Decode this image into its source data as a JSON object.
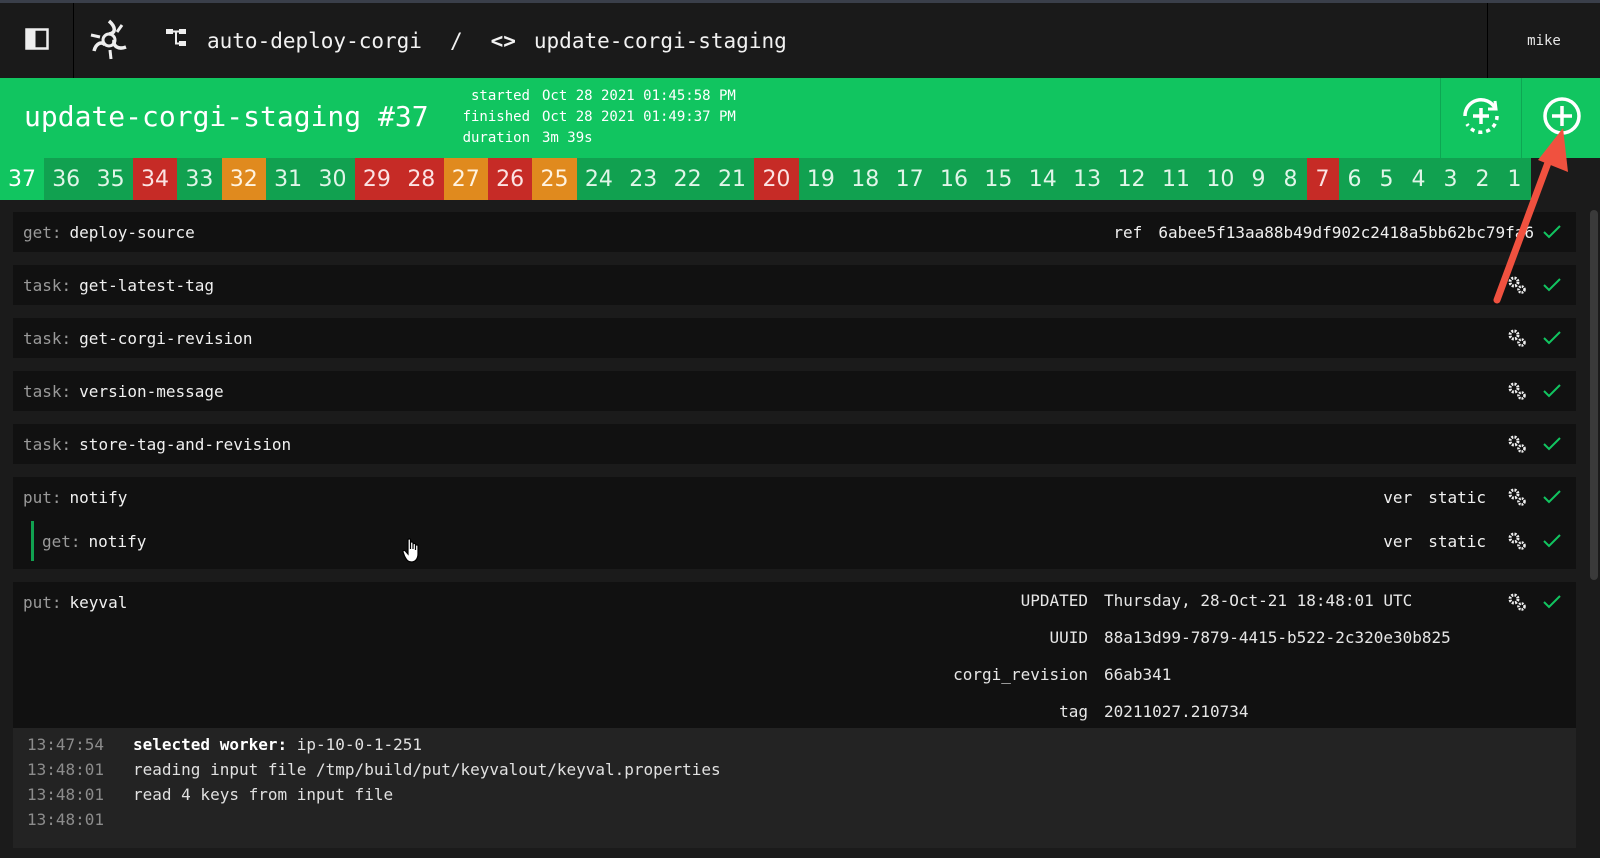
{
  "topbar": {
    "pipeline": "auto-deploy-corgi",
    "separator": "/",
    "job_icon": "<>",
    "job": "update-corgi-staging",
    "user": "mike"
  },
  "build": {
    "title": "update-corgi-staging #37",
    "started_label": "started",
    "started": "Oct 28 2021 01:45:58 PM",
    "finished_label": "finished",
    "finished": "Oct 28 2021 01:49:37 PM",
    "duration_label": "duration",
    "duration": "3m 39s"
  },
  "builds": [
    {
      "n": "37",
      "status": "current"
    },
    {
      "n": "36",
      "status": "succeeded"
    },
    {
      "n": "35",
      "status": "succeeded"
    },
    {
      "n": "34",
      "status": "failed"
    },
    {
      "n": "33",
      "status": "succeeded"
    },
    {
      "n": "32",
      "status": "errored"
    },
    {
      "n": "31",
      "status": "succeeded"
    },
    {
      "n": "30",
      "status": "succeeded"
    },
    {
      "n": "29",
      "status": "failed"
    },
    {
      "n": "28",
      "status": "failed"
    },
    {
      "n": "27",
      "status": "errored"
    },
    {
      "n": "26",
      "status": "failed"
    },
    {
      "n": "25",
      "status": "errored"
    },
    {
      "n": "24",
      "status": "succeeded"
    },
    {
      "n": "23",
      "status": "succeeded"
    },
    {
      "n": "22",
      "status": "succeeded"
    },
    {
      "n": "21",
      "status": "succeeded"
    },
    {
      "n": "20",
      "status": "failed"
    },
    {
      "n": "19",
      "status": "succeeded"
    },
    {
      "n": "18",
      "status": "succeeded"
    },
    {
      "n": "17",
      "status": "succeeded"
    },
    {
      "n": "16",
      "status": "succeeded"
    },
    {
      "n": "15",
      "status": "succeeded"
    },
    {
      "n": "14",
      "status": "succeeded"
    },
    {
      "n": "13",
      "status": "succeeded"
    },
    {
      "n": "12",
      "status": "succeeded"
    },
    {
      "n": "11",
      "status": "succeeded"
    },
    {
      "n": "10",
      "status": "succeeded"
    },
    {
      "n": "9",
      "status": "succeeded"
    },
    {
      "n": "8",
      "status": "succeeded"
    },
    {
      "n": "7",
      "status": "failed"
    },
    {
      "n": "6",
      "status": "succeeded"
    },
    {
      "n": "5",
      "status": "succeeded"
    },
    {
      "n": "4",
      "status": "succeeded"
    },
    {
      "n": "3",
      "status": "succeeded"
    },
    {
      "n": "2",
      "status": "succeeded"
    },
    {
      "n": "1",
      "status": "succeeded"
    }
  ],
  "steps": {
    "get_source": {
      "type": "get:",
      "name": "deploy-source",
      "ref_key": "ref",
      "ref_val": "6abee5f13aa88b49df902c2418a5bb62bc79fa6"
    },
    "task1": {
      "type": "task:",
      "name": "get-latest-tag"
    },
    "task2": {
      "type": "task:",
      "name": "get-corgi-revision"
    },
    "task3": {
      "type": "task:",
      "name": "version-message"
    },
    "task4": {
      "type": "task:",
      "name": "store-tag-and-revision"
    },
    "put_notify": {
      "type": "put:",
      "name": "notify",
      "k": "ver",
      "v": "static"
    },
    "get_notify": {
      "type": "get:",
      "name": "notify",
      "k": "ver",
      "v": "static"
    },
    "put_keyval": {
      "type": "put:",
      "name": "keyval",
      "rows": [
        {
          "k": "UPDATED",
          "v": "Thursday, 28-Oct-21 18:48:01 UTC"
        },
        {
          "k": "UUID",
          "v": "88a13d99-7879-4415-b522-2c320e30b825"
        },
        {
          "k": "corgi_revision",
          "v": "66ab341"
        },
        {
          "k": "tag",
          "v": "20211027.210734"
        }
      ]
    }
  },
  "log": [
    {
      "ts": "13:47:54",
      "bold": "selected worker:",
      "text": " ip-10-0-1-251"
    },
    {
      "ts": "13:48:01",
      "bold": "",
      "text": "reading input file /tmp/build/put/keyvalout/keyval.properties"
    },
    {
      "ts": "13:48:01",
      "bold": "",
      "text": "read 4 keys from input file"
    },
    {
      "ts": "13:48:01",
      "bold": "",
      "text": ""
    }
  ],
  "colors": {
    "succeeded": "#11a150",
    "current": "#11c560",
    "failed": "#c62b26",
    "errored": "#e08a1e",
    "annotation": "#f0513f"
  }
}
